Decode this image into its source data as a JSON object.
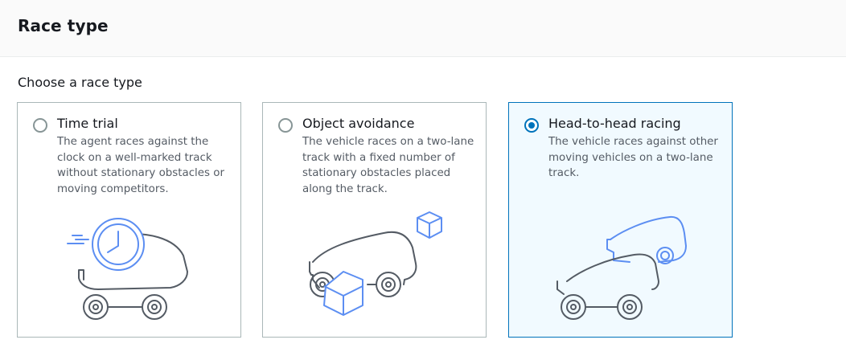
{
  "header": {
    "title": "Race type"
  },
  "race_group": {
    "label": "Choose a race type",
    "options": [
      {
        "title": "Time trial",
        "description": "The agent races against the clock on a well-marked track without stationary obstacles or moving competitors.",
        "selected": false
      },
      {
        "title": "Object avoidance",
        "description": "The vehicle races on a two-lane track with a fixed number of stationary obstacles placed along the track.",
        "selected": false
      },
      {
        "title": "Head-to-head racing",
        "description": "The vehicle races against other moving vehicles on a two-lane track.",
        "selected": true
      }
    ]
  },
  "colors": {
    "accent": "#0073bb",
    "illustration_gray": "#545b64",
    "illustration_blue": "#5c8ef2"
  },
  "icons": [
    "clock-car-illustration",
    "obstacle-car-illustration",
    "two-cars-illustration"
  ]
}
